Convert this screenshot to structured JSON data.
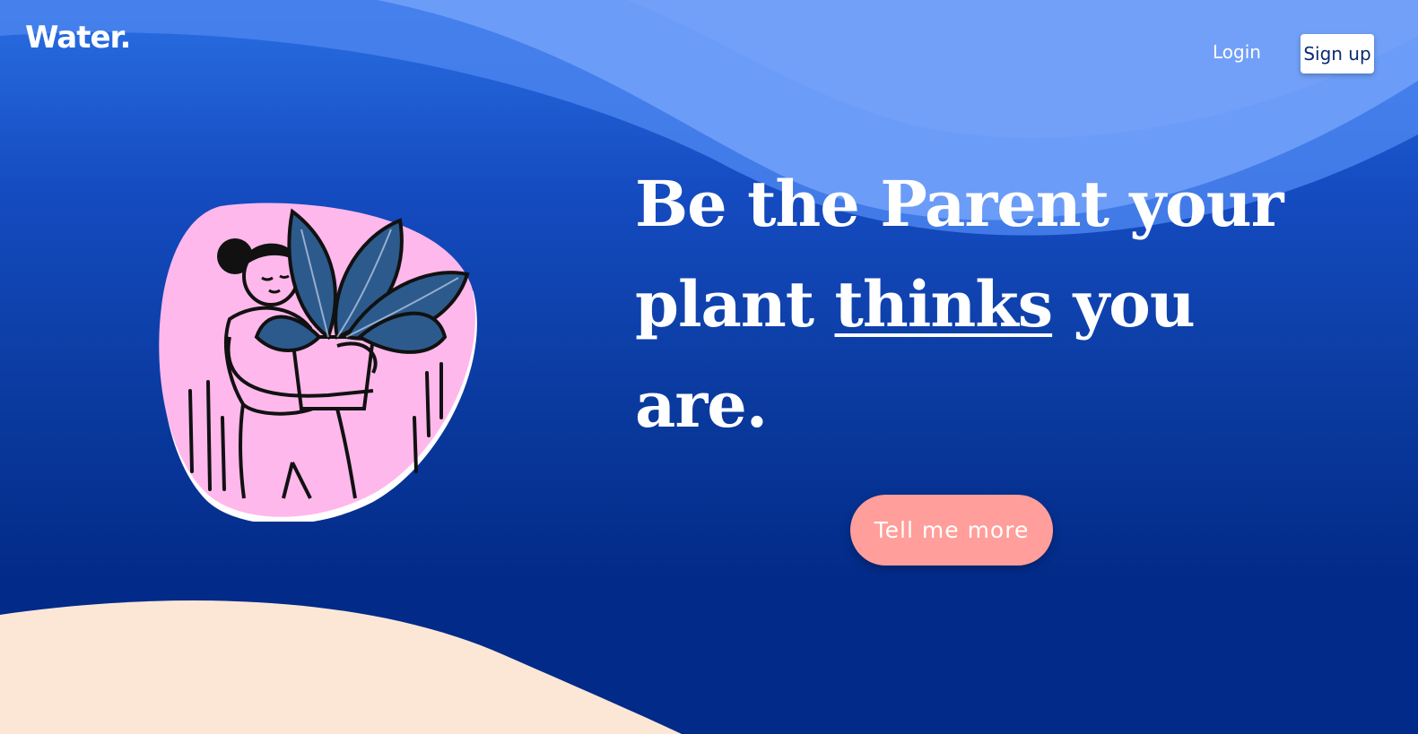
{
  "brand": {
    "logo_text": "Water."
  },
  "nav": {
    "login_label": "Login",
    "signup_label": "Sign up"
  },
  "hero": {
    "headline_part1": "Be the Parent your plant ",
    "headline_emphasis": "thinks",
    "headline_part2": " you are.",
    "cta_label": "Tell me more"
  },
  "colors": {
    "cta_background": "#ff9e9a",
    "wave_light": "#6b9cf7",
    "sand": "#fce7d6",
    "illustration_pink": "#ffb8ec",
    "leaf_blue": "#2d5a8c"
  },
  "icons": {
    "illustration": "person-holding-plant-illustration"
  }
}
